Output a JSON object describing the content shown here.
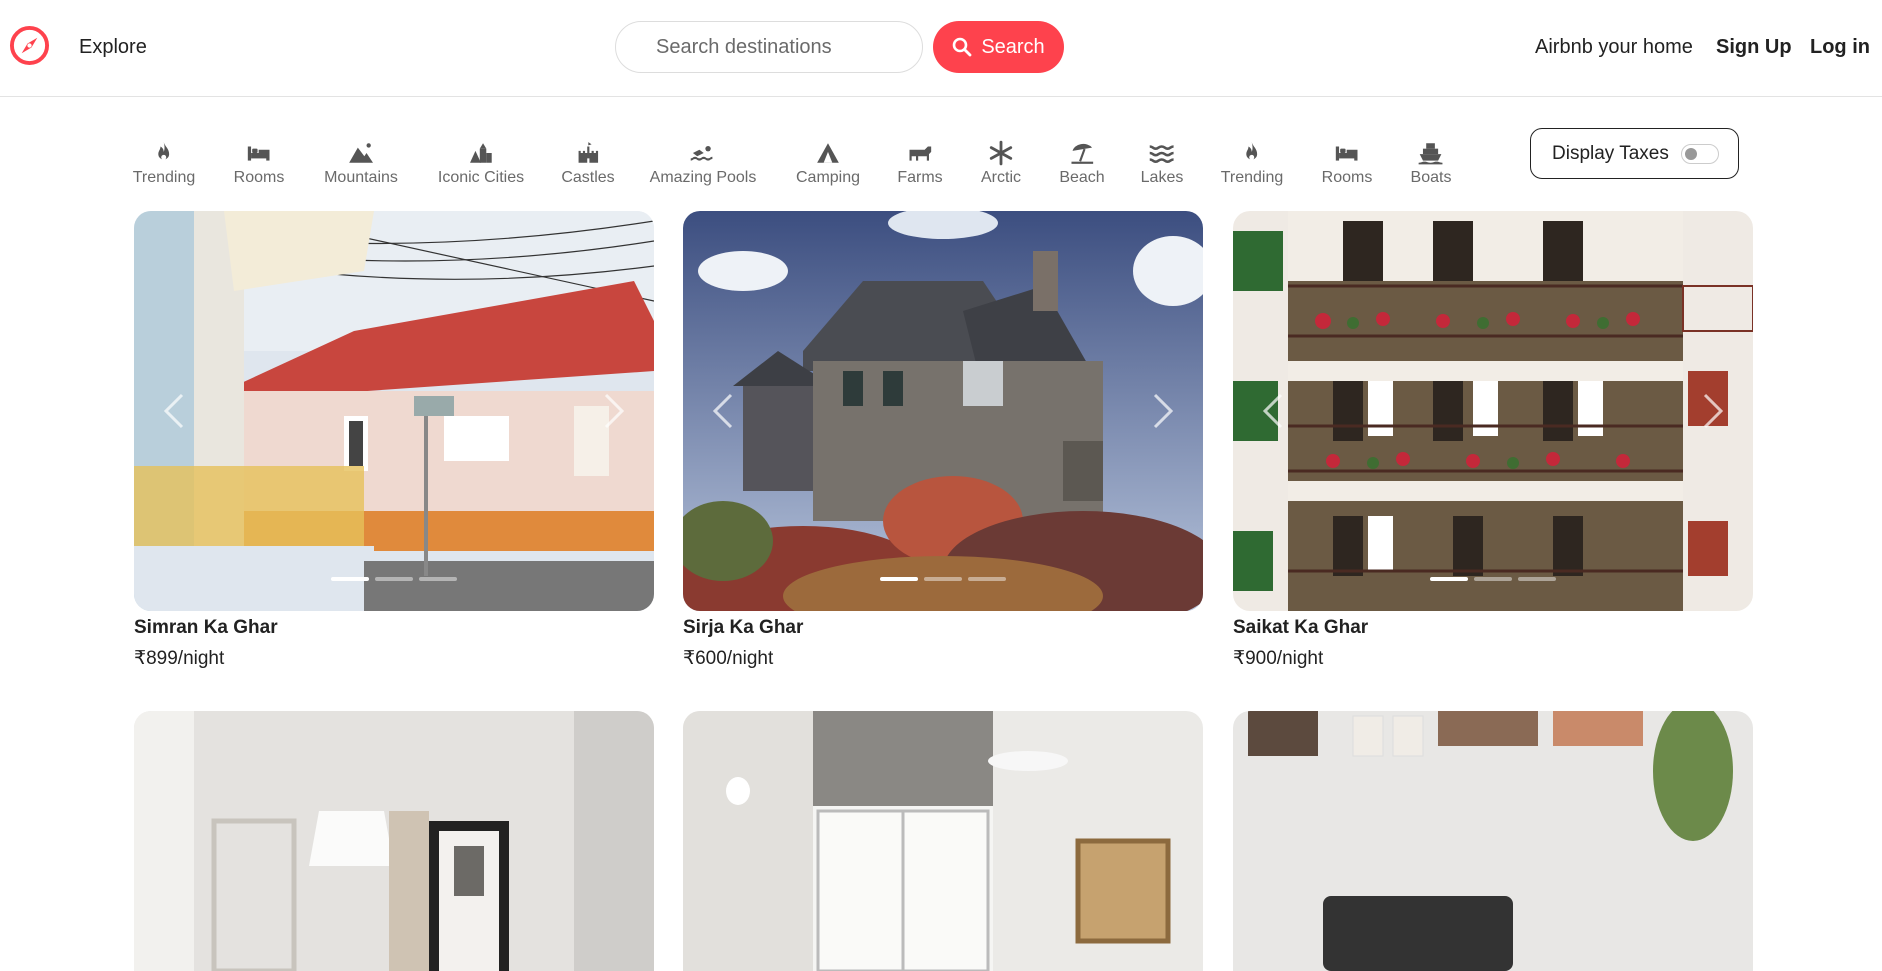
{
  "header": {
    "explore": "Explore",
    "search_placeholder": "Search destinations",
    "search_button": "Search",
    "host_link": "Airbnb your home",
    "signup": "Sign Up",
    "login": "Log in",
    "brand_color": "#fe424d"
  },
  "filters": [
    {
      "label": "Trending",
      "icon": "fire-icon"
    },
    {
      "label": "Rooms",
      "icon": "bed-icon"
    },
    {
      "label": "Mountains",
      "icon": "mountain-icon"
    },
    {
      "label": "Iconic Cities",
      "icon": "city-icon"
    },
    {
      "label": "Castles",
      "icon": "castle-icon"
    },
    {
      "label": "Amazing Pools",
      "icon": "swimmer-icon"
    },
    {
      "label": "Camping",
      "icon": "tent-icon"
    },
    {
      "label": "Farms",
      "icon": "cow-icon"
    },
    {
      "label": "Arctic",
      "icon": "snowflake-icon"
    },
    {
      "label": "Beach",
      "icon": "umbrella-beach-icon"
    },
    {
      "label": "Lakes",
      "icon": "water-icon"
    },
    {
      "label": "Trending",
      "icon": "fire-icon"
    },
    {
      "label": "Rooms",
      "icon": "bed-icon"
    },
    {
      "label": "Boats",
      "icon": "ship-icon"
    }
  ],
  "tax_toggle": {
    "label": "Display Taxes",
    "on": false
  },
  "listings": [
    {
      "title": "Simran Ka Ghar",
      "price": "₹899/night"
    },
    {
      "title": "Sirja Ka Ghar",
      "price": "₹600/night"
    },
    {
      "title": "Saikat Ka Ghar",
      "price": "₹900/night"
    }
  ]
}
